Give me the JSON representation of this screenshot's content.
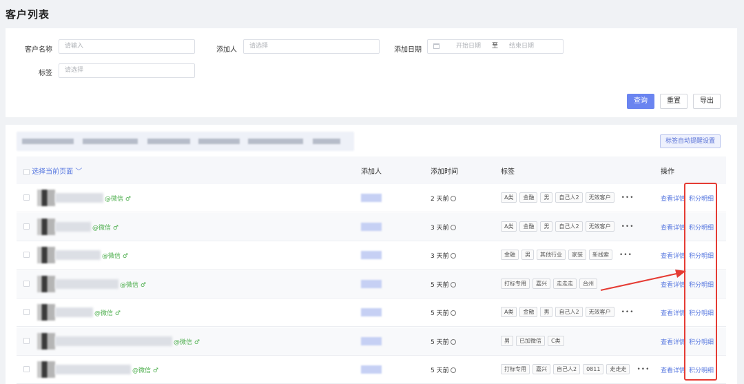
{
  "page": {
    "title": "客户列表"
  },
  "filters": {
    "customer_name_label": "客户名称",
    "customer_name_placeholder": "请输入",
    "adder_label": "添加人",
    "adder_placeholder": "请选择",
    "date_label": "添加日期",
    "date_start_placeholder": "开始日期",
    "date_separator": "至",
    "date_end_placeholder": "结束日期",
    "tag_label": "标签",
    "tag_placeholder": "请选择"
  },
  "actions": {
    "query": "查询",
    "reset": "重置",
    "export": "导出",
    "tag_remind": "标签自动提醒设置"
  },
  "table": {
    "headers": {
      "select": "选择当前页面",
      "adder": "添加人",
      "time": "添加时间",
      "tags": "标签",
      "ops": "操作"
    },
    "op_detail": "查看详情",
    "op_points": "积分明细",
    "more": "•••",
    "rows": [
      {
        "suffix": "@微信 ♂",
        "time": "2 天前",
        "tags": [
          "A类",
          "金融",
          "男",
          "自己人2",
          "无效客户"
        ],
        "more": true
      },
      {
        "suffix": "@微信 ♂",
        "time": "3 天前",
        "tags": [
          "A类",
          "金融",
          "男",
          "自己人2",
          "无效客户"
        ],
        "more": true
      },
      {
        "suffix": "@微信 ♂",
        "time": "3 天前",
        "tags": [
          "金融",
          "男",
          "其他行业",
          "家装",
          "新线索"
        ],
        "more": true
      },
      {
        "suffix": "@微信 ♂",
        "time": "5 天前",
        "tags": [
          "打标专用",
          "嘉兴",
          "走走走",
          "台州"
        ],
        "more": false
      },
      {
        "suffix": "@微信 ♂",
        "time": "5 天前",
        "tags": [
          "A类",
          "金融",
          "男",
          "自己人2",
          "无效客户"
        ],
        "more": true
      },
      {
        "suffix": "@微信 ♂",
        "time": "5 天前",
        "tags": [
          "男",
          "已加微信",
          "C类"
        ],
        "more": false
      },
      {
        "suffix": "@微信 ♂",
        "time": "5 天前",
        "tags": [
          "打标专用",
          "嘉兴",
          "自己人2",
          "0811",
          "走走走"
        ],
        "more": true
      }
    ]
  },
  "colors": {
    "primary": "#6a84f0",
    "wechat": "#4cae4c",
    "link": "#5a7ae0",
    "highlight": "#e53b33"
  }
}
